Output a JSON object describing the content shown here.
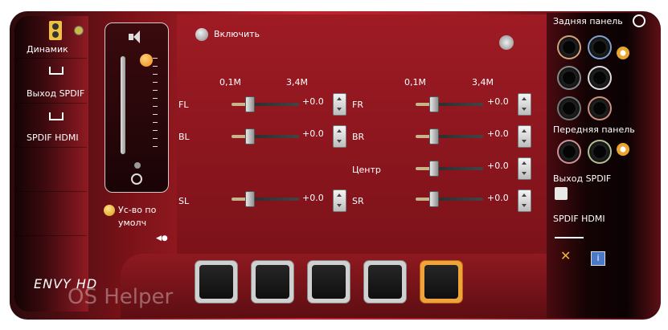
{
  "left_sidebar": {
    "items": [
      {
        "label": "Динамик",
        "icon": "speaker-icon"
      },
      {
        "label": "Выход SPDIF",
        "icon": "pulse-wave-icon"
      },
      {
        "label": "SPDIF HDMI",
        "icon": "pulse-wave-icon"
      }
    ],
    "default_device_label": "Ус-во по умолч",
    "brand": "ENVY HD",
    "watermark": "OS Helper"
  },
  "main": {
    "enable_label": "Включить",
    "range_labels": [
      "0,1M",
      "3,4M",
      "0,1M",
      "3,4M"
    ],
    "channels": [
      {
        "name": "FL",
        "value": "+0.0",
        "level": 0.2
      },
      {
        "name": "FR",
        "value": "+0.0",
        "level": 0.2
      },
      {
        "name": "BL",
        "value": "+0.0",
        "level": 0.2
      },
      {
        "name": "BR",
        "value": "+0.0",
        "level": 0.2
      },
      {
        "name": "Центр",
        "value": "+0.0",
        "level": 0.2
      },
      {
        "name": "SL",
        "value": "+0.0",
        "level": 0.2
      },
      {
        "name": "SR",
        "value": "+0.0",
        "level": 0.2
      }
    ]
  },
  "right_panel": {
    "rear_label": "Задняя панель",
    "front_label": "Передняя панель",
    "spdif_out_label": "Выход SPDIF",
    "spdif_hdmi_label": "SPDIF HDMI"
  },
  "tabs": [
    {
      "name": "speaker-config-icon",
      "active": false
    },
    {
      "name": "sine-wave-icon",
      "active": false
    },
    {
      "name": "equalizer-icon",
      "active": false
    },
    {
      "name": "environment-trees-icon",
      "active": false
    },
    {
      "name": "room-speaker-distance-icon",
      "active": true
    }
  ],
  "colors": {
    "accent": "#f0a33a",
    "primary": "#b2222b",
    "dark": "#140304"
  }
}
